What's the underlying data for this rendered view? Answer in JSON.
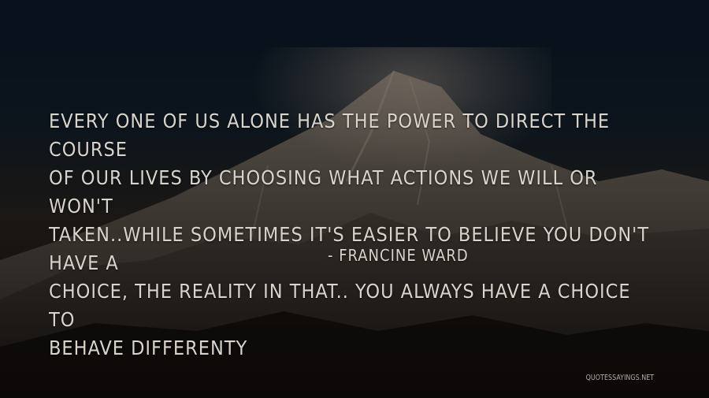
{
  "quote": {
    "text": "EVERY ONE OF US ALONE HAS THE POWER TO DIRECT THE COURSE\nOF OUR LIVES BY CHOOSING WHAT ACTIONS WE WILL OR WON'T\nTAKEN..WHILE SOMETIMES IT'S EASIER TO BELIEVE YOU DON'T HAVE A\nCHOICE, THE REALITY IN THAT.. YOU ALWAYS HAVE A CHOICE TO\nBEHAVE DIFFERENTY",
    "author": "- FRANCINE WARD"
  },
  "watermark": "QUOTESSAYINGS.NET",
  "colors": {
    "text": "#d8d4cc",
    "sky": "#0c1a2a",
    "mountain_light": "#8a8078",
    "mountain_dark": "#1a1512"
  }
}
